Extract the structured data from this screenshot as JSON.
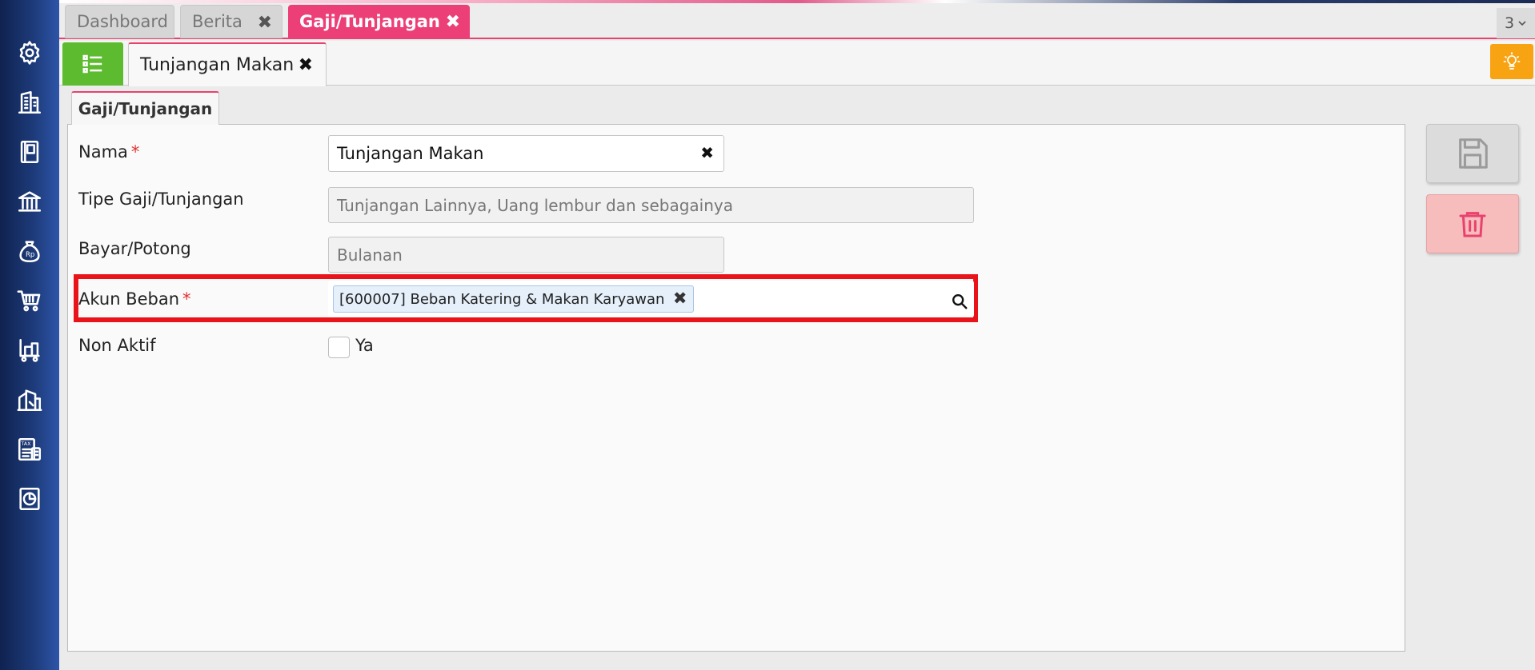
{
  "top_tabs": [
    {
      "label": "Dashboard",
      "closable": false,
      "active": false
    },
    {
      "label": "Berita",
      "closable": true,
      "active": false
    },
    {
      "label": "Gaji/Tunjangan",
      "closable": true,
      "active": true
    }
  ],
  "tab_count": "3",
  "sub_tab": {
    "label": "Tunjangan Makan"
  },
  "inner_tab": {
    "label": "Gaji/Tunjangan"
  },
  "form": {
    "nama": {
      "label": "Nama",
      "required_mark": "*",
      "value": "Tunjangan Makan"
    },
    "tipe": {
      "label": "Tipe Gaji/Tunjangan",
      "value": "Tunjangan Lainnya, Uang lembur dan sebagainya"
    },
    "bayar": {
      "label": "Bayar/Potong",
      "value": "Bulanan"
    },
    "akun_beban": {
      "label": "Akun Beban",
      "required_mark": "*",
      "chip": "[600007] Beban Katering & Makan Karyawan"
    },
    "non_aktif": {
      "label": "Non Aktif",
      "checkbox_label": "Ya",
      "checked": false
    }
  },
  "icons": {
    "sidebar": [
      "gear-icon",
      "building-icon",
      "book-icon",
      "bank-icon",
      "money-bag-icon",
      "cart-icon",
      "trolley-icon",
      "warehouse-icon",
      "tax-icon",
      "report-icon"
    ],
    "close": "close-icon",
    "menu": "list-icon",
    "bulb": "lightbulb-icon",
    "save": "save-icon",
    "delete": "trash-icon",
    "search": "search-icon"
  },
  "colors": {
    "sidebar": "#1d3a78",
    "accent": "#ec3f78",
    "menu_green": "#5dbb2f",
    "bulb_orange": "#f8a312",
    "highlight_red": "#e8141a",
    "delete_pink": "#f7bcbc"
  }
}
